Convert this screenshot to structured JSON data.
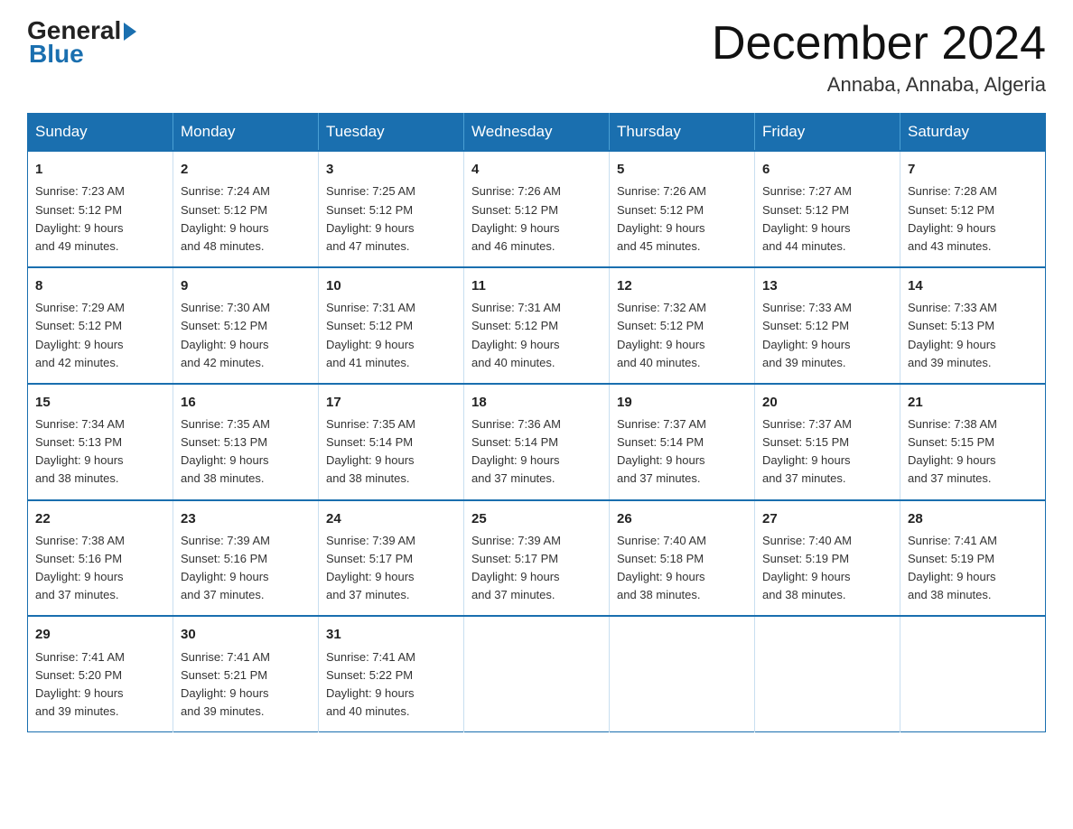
{
  "header": {
    "logo_general": "General",
    "logo_blue": "Blue",
    "month_title": "December 2024",
    "location": "Annaba, Annaba, Algeria"
  },
  "weekdays": [
    "Sunday",
    "Monday",
    "Tuesday",
    "Wednesday",
    "Thursday",
    "Friday",
    "Saturday"
  ],
  "weeks": [
    [
      {
        "day": "1",
        "sunrise": "7:23 AM",
        "sunset": "5:12 PM",
        "daylight": "9 hours and 49 minutes."
      },
      {
        "day": "2",
        "sunrise": "7:24 AM",
        "sunset": "5:12 PM",
        "daylight": "9 hours and 48 minutes."
      },
      {
        "day": "3",
        "sunrise": "7:25 AM",
        "sunset": "5:12 PM",
        "daylight": "9 hours and 47 minutes."
      },
      {
        "day": "4",
        "sunrise": "7:26 AM",
        "sunset": "5:12 PM",
        "daylight": "9 hours and 46 minutes."
      },
      {
        "day": "5",
        "sunrise": "7:26 AM",
        "sunset": "5:12 PM",
        "daylight": "9 hours and 45 minutes."
      },
      {
        "day": "6",
        "sunrise": "7:27 AM",
        "sunset": "5:12 PM",
        "daylight": "9 hours and 44 minutes."
      },
      {
        "day": "7",
        "sunrise": "7:28 AM",
        "sunset": "5:12 PM",
        "daylight": "9 hours and 43 minutes."
      }
    ],
    [
      {
        "day": "8",
        "sunrise": "7:29 AM",
        "sunset": "5:12 PM",
        "daylight": "9 hours and 42 minutes."
      },
      {
        "day": "9",
        "sunrise": "7:30 AM",
        "sunset": "5:12 PM",
        "daylight": "9 hours and 42 minutes."
      },
      {
        "day": "10",
        "sunrise": "7:31 AM",
        "sunset": "5:12 PM",
        "daylight": "9 hours and 41 minutes."
      },
      {
        "day": "11",
        "sunrise": "7:31 AM",
        "sunset": "5:12 PM",
        "daylight": "9 hours and 40 minutes."
      },
      {
        "day": "12",
        "sunrise": "7:32 AM",
        "sunset": "5:12 PM",
        "daylight": "9 hours and 40 minutes."
      },
      {
        "day": "13",
        "sunrise": "7:33 AM",
        "sunset": "5:12 PM",
        "daylight": "9 hours and 39 minutes."
      },
      {
        "day": "14",
        "sunrise": "7:33 AM",
        "sunset": "5:13 PM",
        "daylight": "9 hours and 39 minutes."
      }
    ],
    [
      {
        "day": "15",
        "sunrise": "7:34 AM",
        "sunset": "5:13 PM",
        "daylight": "9 hours and 38 minutes."
      },
      {
        "day": "16",
        "sunrise": "7:35 AM",
        "sunset": "5:13 PM",
        "daylight": "9 hours and 38 minutes."
      },
      {
        "day": "17",
        "sunrise": "7:35 AM",
        "sunset": "5:14 PM",
        "daylight": "9 hours and 38 minutes."
      },
      {
        "day": "18",
        "sunrise": "7:36 AM",
        "sunset": "5:14 PM",
        "daylight": "9 hours and 37 minutes."
      },
      {
        "day": "19",
        "sunrise": "7:37 AM",
        "sunset": "5:14 PM",
        "daylight": "9 hours and 37 minutes."
      },
      {
        "day": "20",
        "sunrise": "7:37 AM",
        "sunset": "5:15 PM",
        "daylight": "9 hours and 37 minutes."
      },
      {
        "day": "21",
        "sunrise": "7:38 AM",
        "sunset": "5:15 PM",
        "daylight": "9 hours and 37 minutes."
      }
    ],
    [
      {
        "day": "22",
        "sunrise": "7:38 AM",
        "sunset": "5:16 PM",
        "daylight": "9 hours and 37 minutes."
      },
      {
        "day": "23",
        "sunrise": "7:39 AM",
        "sunset": "5:16 PM",
        "daylight": "9 hours and 37 minutes."
      },
      {
        "day": "24",
        "sunrise": "7:39 AM",
        "sunset": "5:17 PM",
        "daylight": "9 hours and 37 minutes."
      },
      {
        "day": "25",
        "sunrise": "7:39 AM",
        "sunset": "5:17 PM",
        "daylight": "9 hours and 37 minutes."
      },
      {
        "day": "26",
        "sunrise": "7:40 AM",
        "sunset": "5:18 PM",
        "daylight": "9 hours and 38 minutes."
      },
      {
        "day": "27",
        "sunrise": "7:40 AM",
        "sunset": "5:19 PM",
        "daylight": "9 hours and 38 minutes."
      },
      {
        "day": "28",
        "sunrise": "7:41 AM",
        "sunset": "5:19 PM",
        "daylight": "9 hours and 38 minutes."
      }
    ],
    [
      {
        "day": "29",
        "sunrise": "7:41 AM",
        "sunset": "5:20 PM",
        "daylight": "9 hours and 39 minutes."
      },
      {
        "day": "30",
        "sunrise": "7:41 AM",
        "sunset": "5:21 PM",
        "daylight": "9 hours and 39 minutes."
      },
      {
        "day": "31",
        "sunrise": "7:41 AM",
        "sunset": "5:22 PM",
        "daylight": "9 hours and 40 minutes."
      },
      null,
      null,
      null,
      null
    ]
  ]
}
